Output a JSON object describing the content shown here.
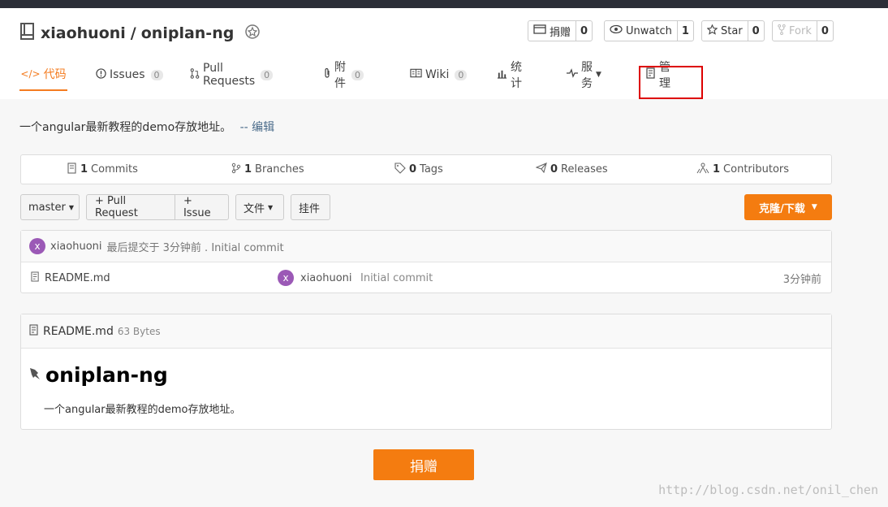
{
  "repo": {
    "owner": "xiaohuoni",
    "separator": "/",
    "name": "oniplan-ng"
  },
  "actions": {
    "donate": {
      "label": "捐赠",
      "count": "0"
    },
    "watch": {
      "label": "Unwatch",
      "count": "1"
    },
    "star": {
      "label": "Star",
      "count": "0"
    },
    "fork": {
      "label": "Fork",
      "count": "0"
    }
  },
  "tabs": [
    {
      "label": "代码"
    },
    {
      "label": "Issues",
      "count": "0"
    },
    {
      "label": "Pull Requests",
      "count": "0"
    },
    {
      "label": "附件",
      "count": "0"
    },
    {
      "label": "Wiki",
      "count": "0"
    },
    {
      "label": "统计"
    },
    {
      "label": "服务"
    },
    {
      "label": "管理"
    }
  ],
  "description": {
    "text": "一个angular最新教程的demo存放地址。",
    "edit": "-- 编辑"
  },
  "stats": [
    {
      "count": "1",
      "label": "Commits"
    },
    {
      "count": "1",
      "label": "Branches"
    },
    {
      "count": "0",
      "label": "Tags"
    },
    {
      "count": "0",
      "label": "Releases"
    },
    {
      "count": "1",
      "label": "Contributors"
    }
  ],
  "toolbar": {
    "branch": "master",
    "pull_request": "+ Pull Request",
    "issue": "+ Issue",
    "files": "文件",
    "widget": "挂件",
    "clone": "克隆/下载"
  },
  "latest_commit": {
    "avatar_letter": "x",
    "author": "xiaohuoni",
    "text": "最后提交于 3分钟前 . Initial commit"
  },
  "files": [
    {
      "name": "README.md",
      "avatar_letter": "x",
      "author": "xiaohuoni",
      "message": "Initial commit",
      "time": "3分钟前"
    }
  ],
  "readme": {
    "filename": "README.md",
    "size": "63 Bytes",
    "title": "oniplan-ng",
    "text": "一个angular最新教程的demo存放地址。"
  },
  "donate_button": "捐赠",
  "watermark": "http://blog.csdn.net/onil_chen"
}
